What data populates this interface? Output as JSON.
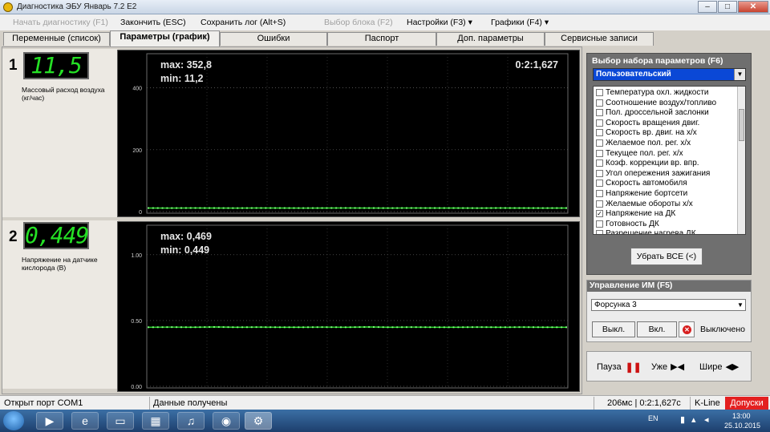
{
  "window": {
    "title": "Диагностика ЭБУ Январь 7.2 E2",
    "buttons": {
      "minimize": "‒",
      "maximize": "□",
      "close": "✕"
    }
  },
  "menu": {
    "start_diag": "Начать диагностику (F1)",
    "finish": "Закончить (ESC)",
    "save_log": "Сохранить лог (Alt+S)",
    "select_block": "Выбор блока (F2)",
    "settings": "Настройки (F3) ▾",
    "charts": "Графики (F4) ▾"
  },
  "tabs": [
    "Переменные (список)",
    "Параметры (график)",
    "Ошибки",
    "Паспорт",
    "Доп. параметры",
    "Сервисные записи"
  ],
  "gauges": [
    {
      "number": "1",
      "value": "11,5",
      "label": "Массовый расход воздуха (кг/час)"
    },
    {
      "number": "2",
      "value": "0,449",
      "label": "Напряжение на датчике кислорода (В)"
    }
  ],
  "plots": [
    {
      "max": "max: 352,8",
      "min": "min: 11,2",
      "time": "0:2:1,627",
      "yticks": [
        "400",
        "200",
        "0"
      ]
    },
    {
      "max": "max: 0,469",
      "min": "min: 0,449",
      "yticks": [
        "1.00",
        "0.50",
        "0.00"
      ]
    }
  ],
  "chart_data": [
    {
      "type": "line",
      "yticks": [
        0,
        200,
        400
      ],
      "series": [
        {
          "values": [
            11.5,
            11.4,
            11.6,
            11.5,
            11.3,
            11.6,
            11.5,
            11.4,
            11.5,
            11.7,
            11.5,
            11.4,
            11.6,
            11.5,
            11.5,
            11.3,
            11.6,
            11.5,
            11.4,
            11.5
          ]
        }
      ],
      "max": 352.8,
      "min": 11.2
    },
    {
      "type": "line",
      "yticks": [
        0.0,
        0.5,
        1.0
      ],
      "series": [
        {
          "values": [
            0.449,
            0.45,
            0.449,
            0.451,
            0.449,
            0.45,
            0.449,
            0.449,
            0.45,
            0.449,
            0.451,
            0.449,
            0.45,
            0.449,
            0.449,
            0.45,
            0.449,
            0.45,
            0.449,
            0.449
          ]
        }
      ],
      "max": 0.469,
      "min": 0.449
    }
  ],
  "param_set": {
    "title": "Выбор набора параметров (F6)",
    "selected": "Пользовательский",
    "items": [
      {
        "label": "Температура охл. жидкости",
        "checked": false
      },
      {
        "label": "Соотношение воздух/топливо",
        "checked": false
      },
      {
        "label": "Пол. дроссельной заслонки",
        "checked": false
      },
      {
        "label": "Скорость вращения двиг.",
        "checked": false
      },
      {
        "label": "Скорость вр. двиг. на х/х",
        "checked": false
      },
      {
        "label": "Желаемое пол. рег. х/х",
        "checked": false
      },
      {
        "label": "Текущее пол. рег. х/х",
        "checked": false
      },
      {
        "label": "Коэф. коррекции вр. впр.",
        "checked": false
      },
      {
        "label": "Угол опережения зажигания",
        "checked": false
      },
      {
        "label": "Скорость автомобиля",
        "checked": false
      },
      {
        "label": "Напряжение бортсети",
        "checked": false
      },
      {
        "label": "Желаемые обороты х/х",
        "checked": false
      },
      {
        "label": "Напряжение на ДК",
        "checked": true
      },
      {
        "label": "Готовность ДК",
        "checked": false
      },
      {
        "label": "Разрешение нагрева ДК",
        "checked": false
      }
    ],
    "remove_all": "Убрать ВСЕ (<)"
  },
  "im_control": {
    "title": "Управление ИМ (F5)",
    "selected": "Форсунка 3",
    "off_btn": "Выкл.",
    "on_btn": "Вкл.",
    "state": "Выключено"
  },
  "playback": {
    "pause": "Пауза",
    "narrow": "Уже",
    "wide": "Шире"
  },
  "status": {
    "port": "Открыт порт COM1",
    "data": "Данные получены",
    "timing": "206мс | 0:2:1,627с",
    "protocol": "K-Line",
    "tolerances": "Допуски"
  },
  "taskbar": {
    "lang": "EN",
    "time": "13:00",
    "date": "25.10.2015"
  },
  "colors": {
    "accent_blue": "#0a48d6",
    "lcd_green": "#25e025",
    "plot_green": "#2ee82e",
    "status_red": "#e32020"
  }
}
